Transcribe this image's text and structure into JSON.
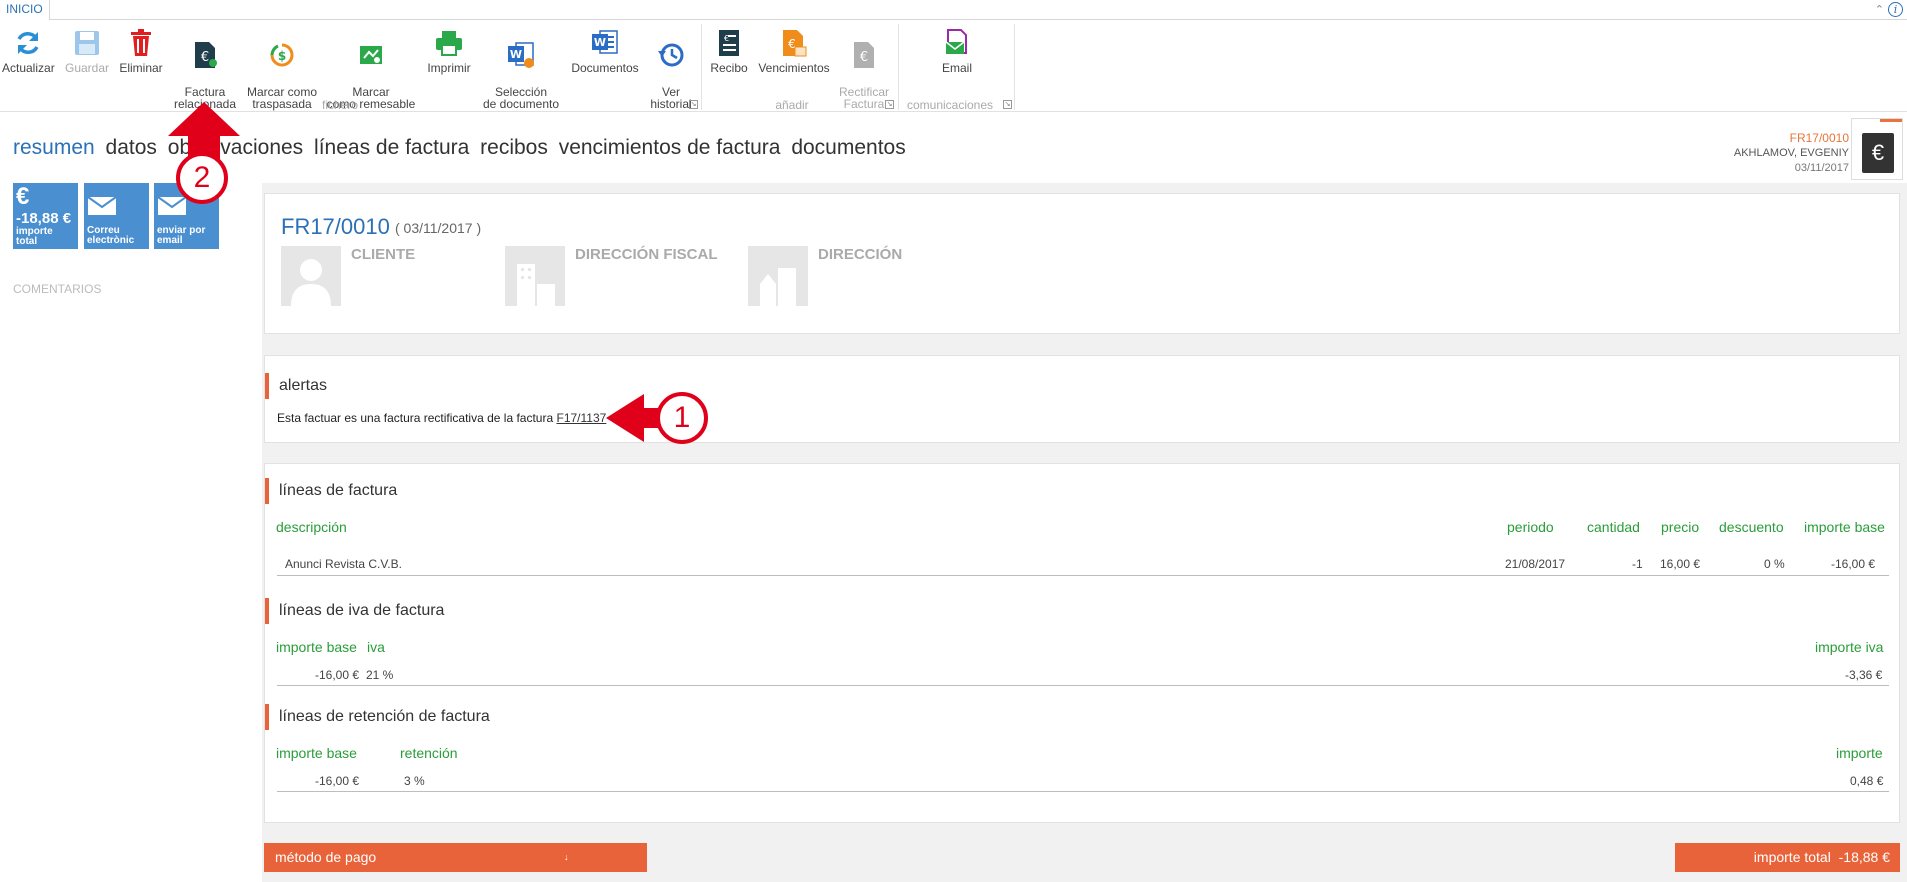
{
  "tabstrip": {
    "tab": "INICIO"
  },
  "ribbon": {
    "buttons": [
      {
        "id": "actualizar",
        "label": "Actualizar",
        "icon": "refresh-icon",
        "disabled": false
      },
      {
        "id": "guardar",
        "label": "Guardar",
        "icon": "save-icon",
        "disabled": true
      },
      {
        "id": "eliminar",
        "label": "Eliminar",
        "icon": "trash-icon",
        "disabled": false
      },
      {
        "id": "factura-relacionada",
        "label": "Factura\nrelacionada",
        "icon": "related-invoice-icon",
        "disabled": false
      },
      {
        "id": "marcar-traspasada",
        "label": "Marcar como\ntraspasada",
        "icon": "transfer-icon",
        "disabled": false
      },
      {
        "id": "marcar-remesable",
        "label": "Marcar\ncomo remesable",
        "icon": "remittable-icon",
        "disabled": false
      },
      {
        "id": "imprimir",
        "label": "Imprimir",
        "icon": "printer-icon",
        "disabled": false
      },
      {
        "id": "seleccion-documento",
        "label": "Selección\nde documento",
        "icon": "word-select-icon",
        "disabled": false
      },
      {
        "id": "documentos",
        "label": "Documentos",
        "icon": "word-document-icon",
        "disabled": false
      },
      {
        "id": "ver-historial",
        "label": "Ver\nhistorial",
        "icon": "history-icon",
        "disabled": false
      },
      {
        "id": "recibo",
        "label": "Recibo",
        "icon": "receipt-icon",
        "disabled": false
      },
      {
        "id": "vencimientos",
        "label": "Vencimientos",
        "icon": "due-dates-icon",
        "disabled": false
      },
      {
        "id": "rectificar-factura",
        "label": "Rectificar\nFactura",
        "icon": "rectify-invoice-icon",
        "disabled": true
      },
      {
        "id": "email",
        "label": "Email",
        "icon": "email-icon",
        "disabled": false
      }
    ],
    "groups": {
      "fichero": "fichero",
      "anadir": "añadir",
      "comunicaciones": "comunicaciones"
    }
  },
  "page_tabs": [
    "resumen",
    "datos",
    "observaciones",
    "líneas de factura",
    "recibos",
    "vencimientos de factura",
    "documentos"
  ],
  "record": {
    "number": "FR17/0010",
    "client": "AKHLAMOV, EVGENIY",
    "date": "03/11/2017"
  },
  "tiles": {
    "total": {
      "value": "-18,88 €",
      "label": "importe\ntotal"
    },
    "email": {
      "label": "Correu\nelectrònic"
    },
    "send": {
      "label": "enviar por\nemail"
    }
  },
  "sidebar": {
    "comentarios": "COMENTARIOS"
  },
  "invoice": {
    "number": "FR17/0010",
    "date": "( 03/11/2017 )",
    "parties": {
      "cliente": "CLIENTE",
      "fiscal": "DIRECCIÓN FISCAL",
      "direccion": "DIRECCIÓN"
    }
  },
  "alertas": {
    "title": "alertas",
    "text": "Esta factuar es una factura rectificativa de la factura",
    "link": "F17/1137"
  },
  "lineas": {
    "title": "líneas de factura",
    "headers": {
      "descripcion": "descripción",
      "periodo": "periodo",
      "cantidad": "cantidad",
      "precio": "precio",
      "descuento": "descuento",
      "importe_base": "importe base"
    },
    "row": {
      "descripcion": "Anunci Revista C.V.B.",
      "periodo": "21/08/2017",
      "cantidad": "-1",
      "precio": "16,00 €",
      "descuento": "0 %",
      "importe_base": "-16,00 €"
    }
  },
  "iva": {
    "title": "líneas de iva de factura",
    "headers": {
      "importe_base": "importe base",
      "iva": "iva",
      "importe_iva": "importe iva"
    },
    "row": {
      "importe_base": "-16,00 €",
      "iva": "21 %",
      "importe_iva": "-3,36 €"
    }
  },
  "retencion": {
    "title": "líneas de retención de factura",
    "headers": {
      "importe_base": "importe base",
      "retencion": "retención",
      "importe": "importe"
    },
    "row": {
      "importe_base": "-16,00 €",
      "retencion": "3 %",
      "importe": "0,48 €"
    }
  },
  "footer": {
    "metodo_pago": "método de pago",
    "total_label": "importe total",
    "total_value": "-18,88 €"
  },
  "annotations": {
    "one": "1",
    "two": "2"
  },
  "colors": {
    "accent_blue": "#2b71b6",
    "accent_orange": "#e8633a",
    "header_green": "#2a9d3a",
    "annotation_red": "#e0001a"
  }
}
